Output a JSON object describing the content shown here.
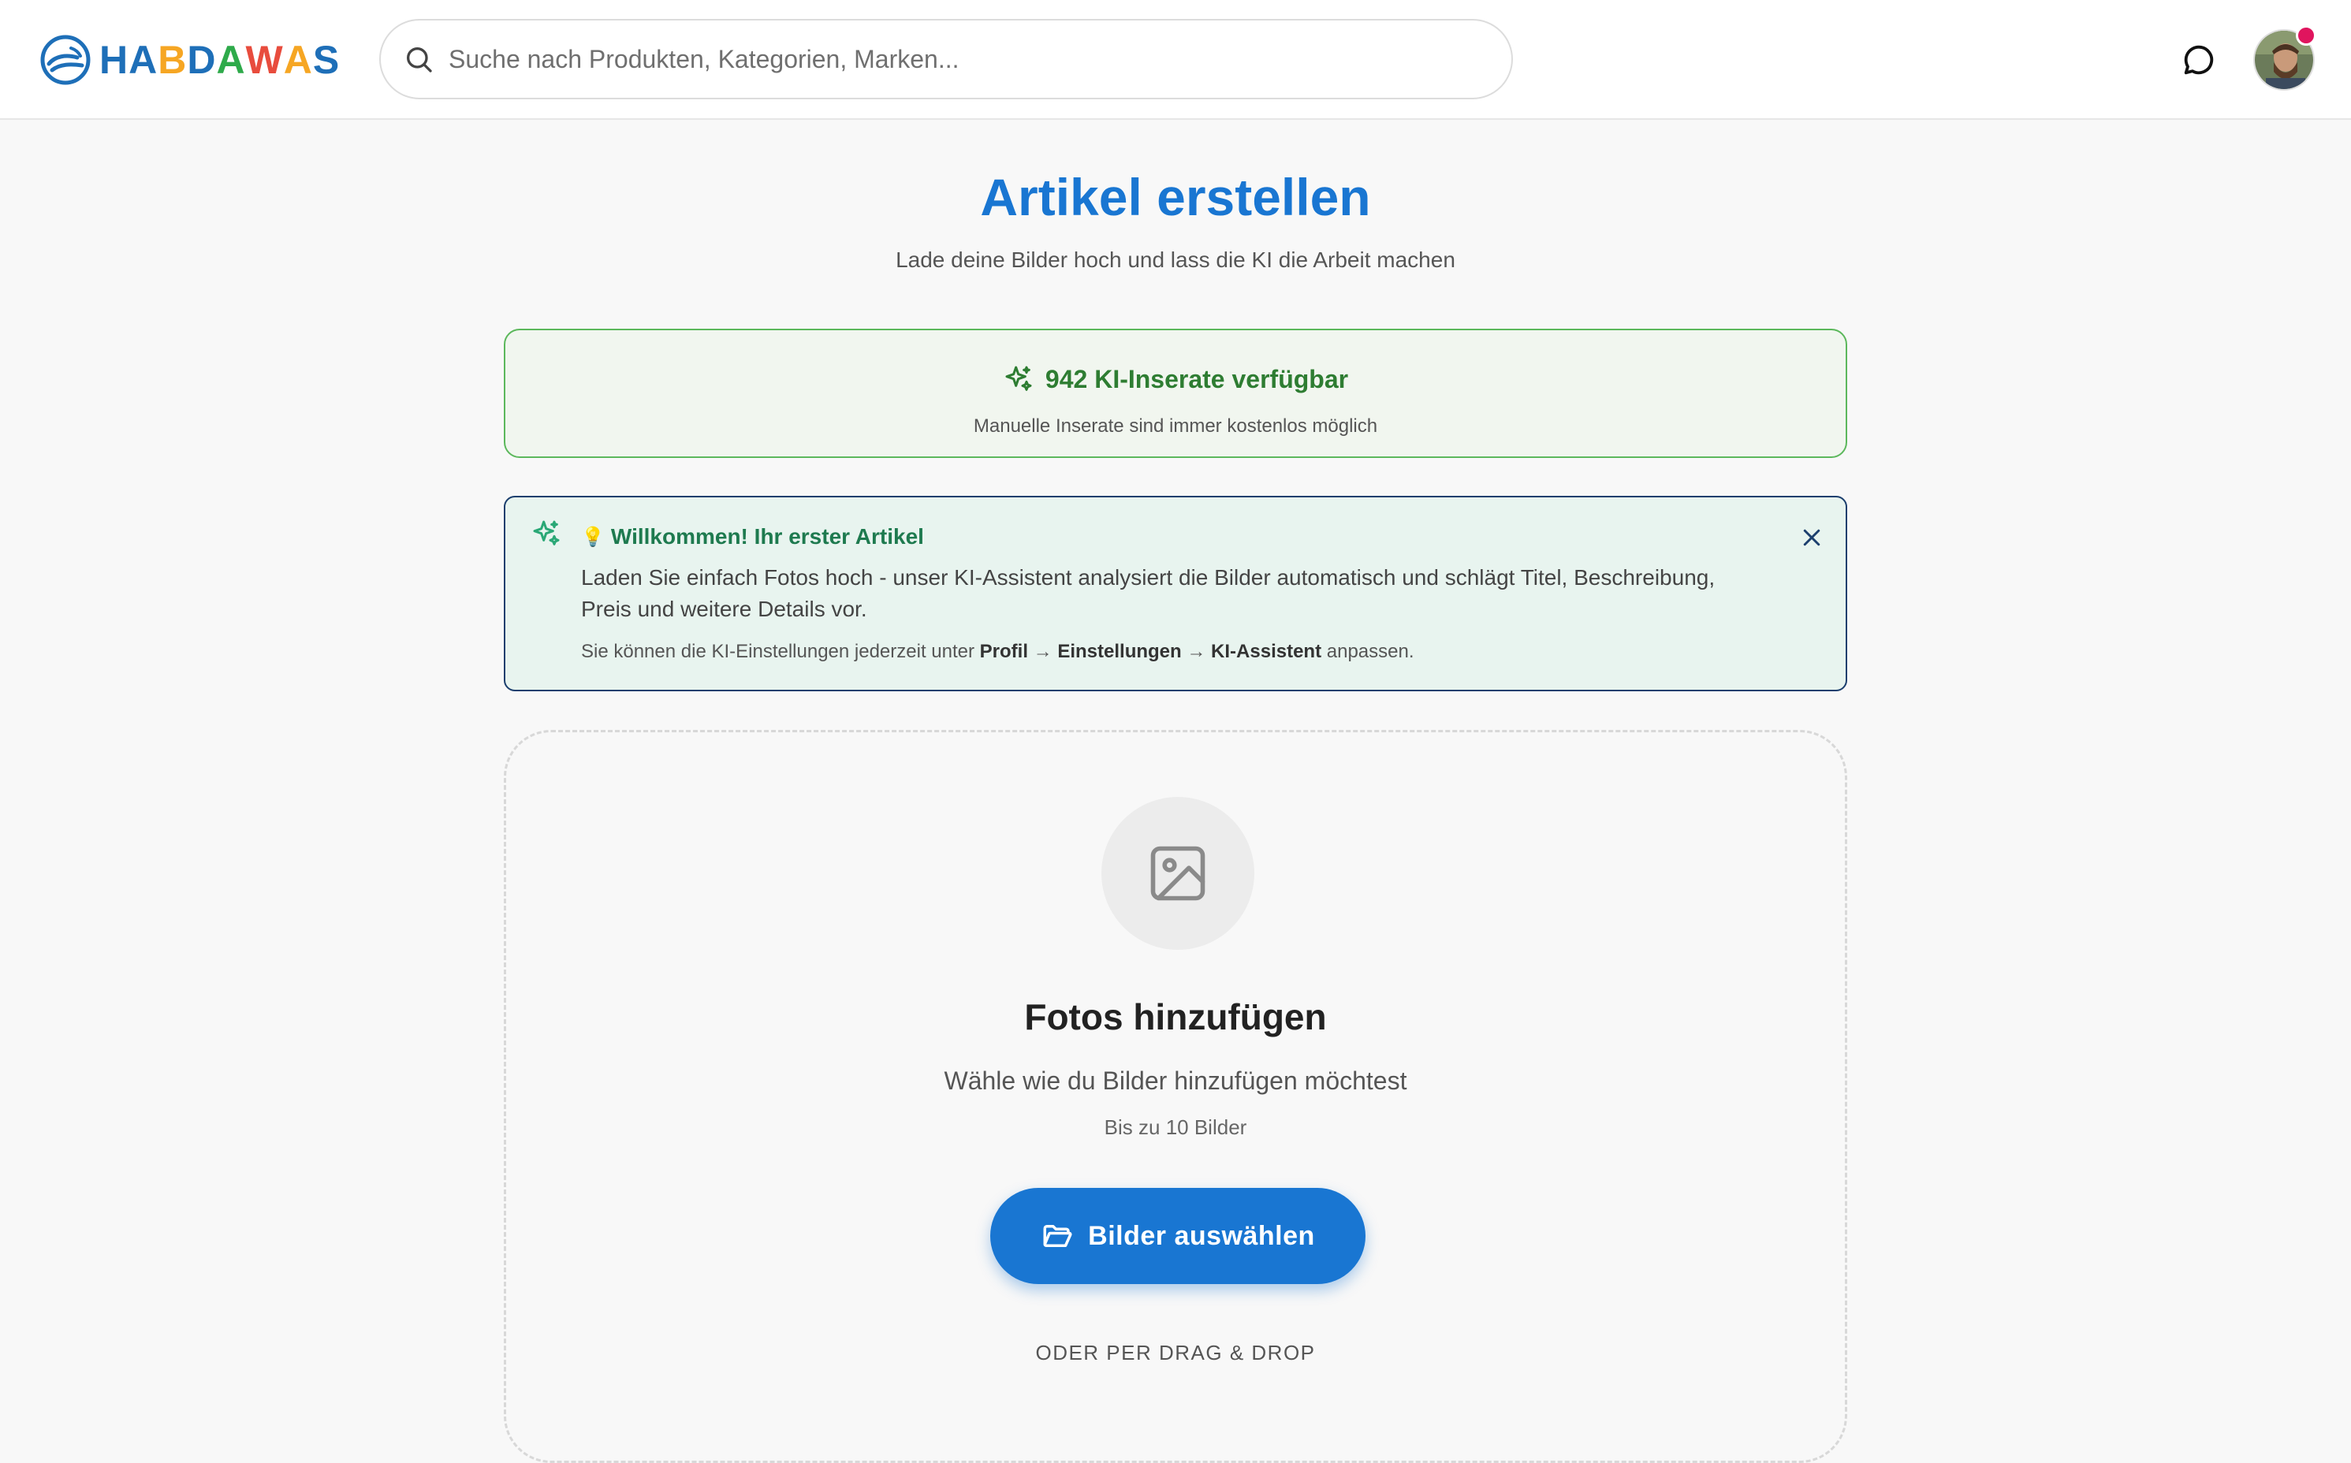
{
  "header": {
    "logo_letters": [
      {
        "ch": "H",
        "color": "#1e6fb8"
      },
      {
        "ch": "A",
        "color": "#1e6fb8"
      },
      {
        "ch": "B",
        "color": "#f6a623"
      },
      {
        "ch": "D",
        "color": "#1e6fb8"
      },
      {
        "ch": "A",
        "color": "#2eaa4a"
      },
      {
        "ch": "W",
        "color": "#e84c3d"
      },
      {
        "ch": "A",
        "color": "#f6a623"
      },
      {
        "ch": "S",
        "color": "#1e6fb8"
      }
    ],
    "search_placeholder": "Suche nach Produkten, Kategorien, Marken..."
  },
  "page": {
    "title": "Artikel erstellen",
    "subtitle": "Lade deine Bilder hoch und lass die KI die Arbeit machen"
  },
  "credits": {
    "count_label": "942 KI-Inserate verfügbar",
    "note": "Manuelle Inserate sind immer kostenlos möglich"
  },
  "welcome": {
    "bulb": "💡",
    "title": "Willkommen! Ihr erster Artikel",
    "body": "Laden Sie einfach Fotos hoch - unser KI-Assistent analysiert die Bilder automatisch und schlägt Titel, Beschreibung, Preis und weitere Details vor.",
    "hint_prefix": "Sie können die KI-Einstellungen jederzeit unter",
    "hint_profile": "Profil",
    "hint_arrow": "→",
    "hint_settings": "Einstellungen",
    "hint_assistant": "KI-Assistent",
    "hint_suffix": "anpassen."
  },
  "upload": {
    "title": "Fotos hinzufügen",
    "subtitle": "Wähle wie du Bilder hinzufügen möchtest",
    "limit": "Bis zu 10 Bilder",
    "button_label": "Bilder auswählen",
    "dnd_label": "ODER PER DRAG & DROP"
  },
  "colors": {
    "accent": "#1976d2",
    "success": "#2e7d32",
    "notification_dot": "#e0155e"
  }
}
